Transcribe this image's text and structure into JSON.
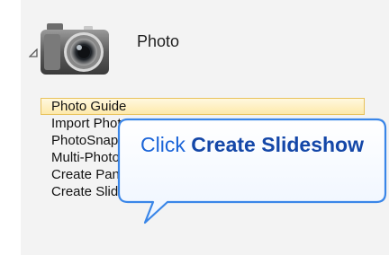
{
  "section": {
    "title": "Photo",
    "icon": "camera-icon",
    "expander_icon": "expander-triangle-icon"
  },
  "menu": {
    "items": [
      {
        "label": "Photo Guide",
        "selected": true
      },
      {
        "label": "Import Photos",
        "selected": false
      },
      {
        "label": "PhotoSnap",
        "selected": false
      },
      {
        "label": "Multi-Photo",
        "selected": false
      },
      {
        "label": "Create Panoramas",
        "selected": false
      },
      {
        "label": "Create Slideshow",
        "selected": false
      }
    ]
  },
  "callout": {
    "prefix": "Click ",
    "target": "Create Slideshow"
  },
  "colors": {
    "panel_bg": "#f3f3f3",
    "selected_bg": "#fde9aa",
    "selected_border": "#e8c25c",
    "callout_border": "#3a86e8",
    "callout_text": "#1a64d8",
    "callout_strong_text": "#1447a8"
  }
}
